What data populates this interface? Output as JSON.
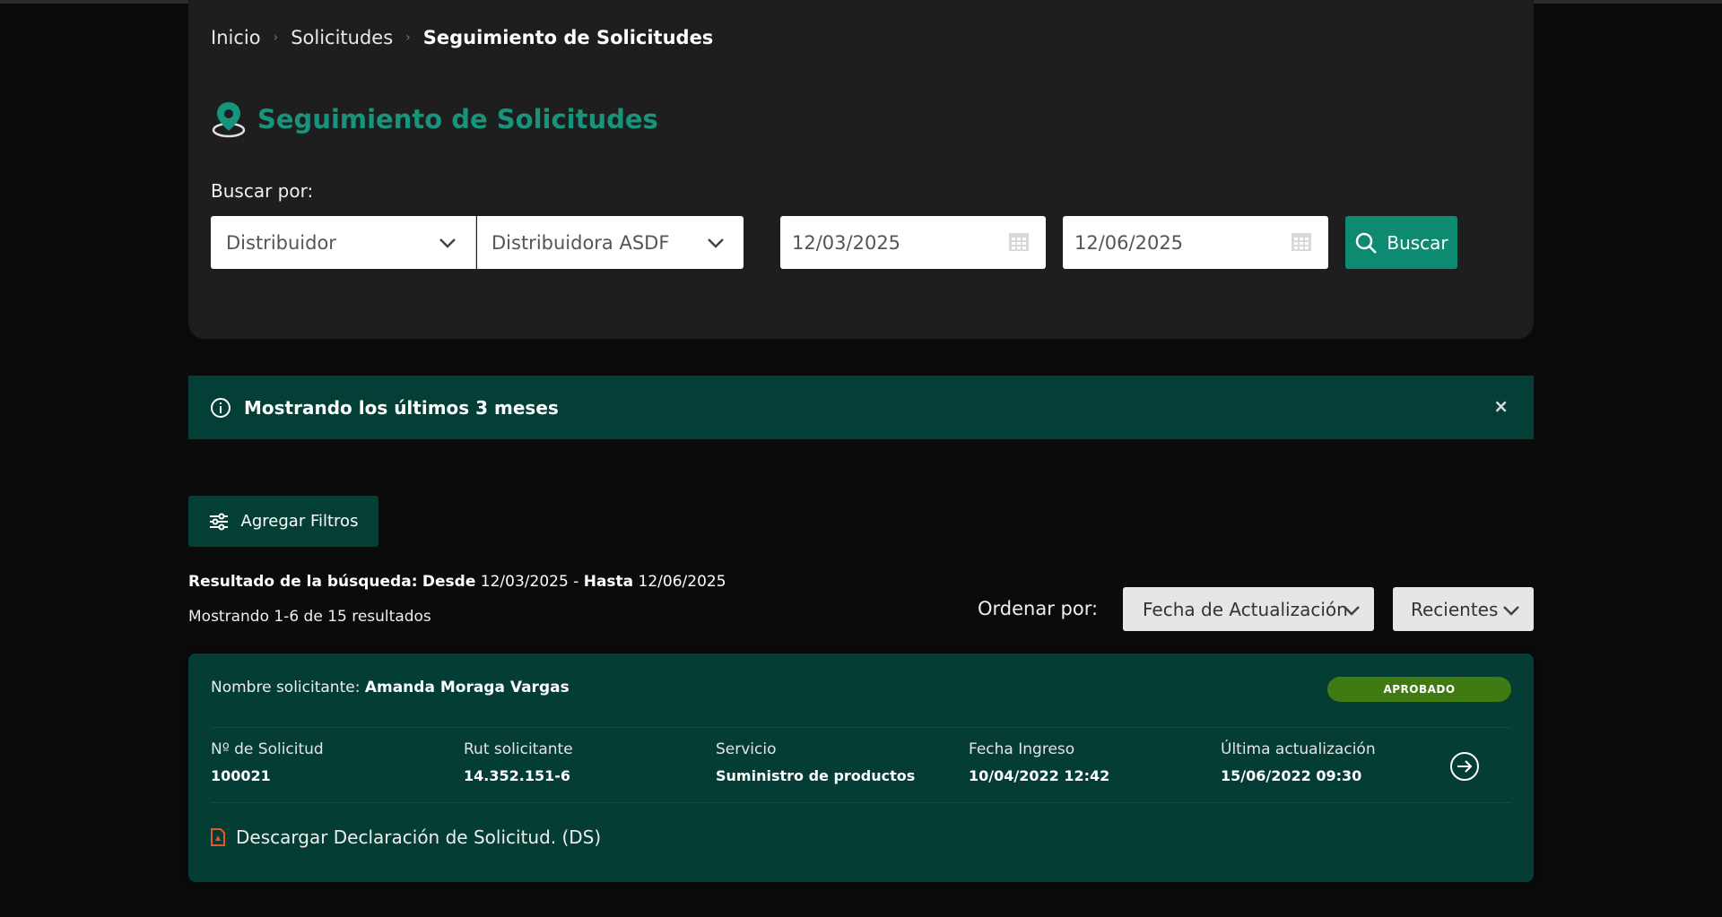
{
  "breadcrumb": {
    "items": [
      "Inicio",
      "Solicitudes"
    ],
    "current": "Seguimiento de Solicitudes"
  },
  "header": {
    "title": "Seguimiento de Solicitudes",
    "icon": "location-pin-icon"
  },
  "search": {
    "label": "Buscar por:",
    "type_value": "Distribuidor",
    "entity_value": "Distribuidora ASDF",
    "date_from": "12/03/2025",
    "date_to": "12/06/2025",
    "button_label": "Buscar"
  },
  "alert": {
    "text": "Mostrando los últimos 3 meses",
    "close": "×"
  },
  "filters": {
    "button_label": "Agregar Filtros"
  },
  "results": {
    "range_label": "Resultado de la búsqueda:",
    "from_label": "Desde",
    "from_value": "12/03/2025",
    "separator": "-",
    "to_label": "Hasta",
    "to_value": "12/06/2025",
    "count_text": "Mostrando 1-6 de 15 resultados"
  },
  "sort": {
    "label": "Ordenar por:",
    "field_value": "Fecha de Actualización",
    "order_value": "Recientes"
  },
  "card": {
    "applicant_label": "Nombre solicitante:",
    "applicant_name": "Amanda Moraga Vargas",
    "status": "APROBADO",
    "fields": [
      {
        "label": "Nº de Solicitud",
        "value": "100021"
      },
      {
        "label": "Rut solicitante",
        "value": "14.352.151-6"
      },
      {
        "label": "Servicio",
        "value": "Suministro de productos"
      },
      {
        "label": "Fecha Ingreso",
        "value": "10/04/2022 12:42"
      },
      {
        "label": "Última actualización",
        "value": "15/06/2022 09:30"
      }
    ],
    "download_label": "Descargar Declaración de Solicitud. (DS)"
  },
  "colors": {
    "accent": "#16957c",
    "button": "#0e8a72",
    "alert_bg": "#033f36",
    "badge": "#3f7a13",
    "pdf_icon": "#e0582b"
  }
}
